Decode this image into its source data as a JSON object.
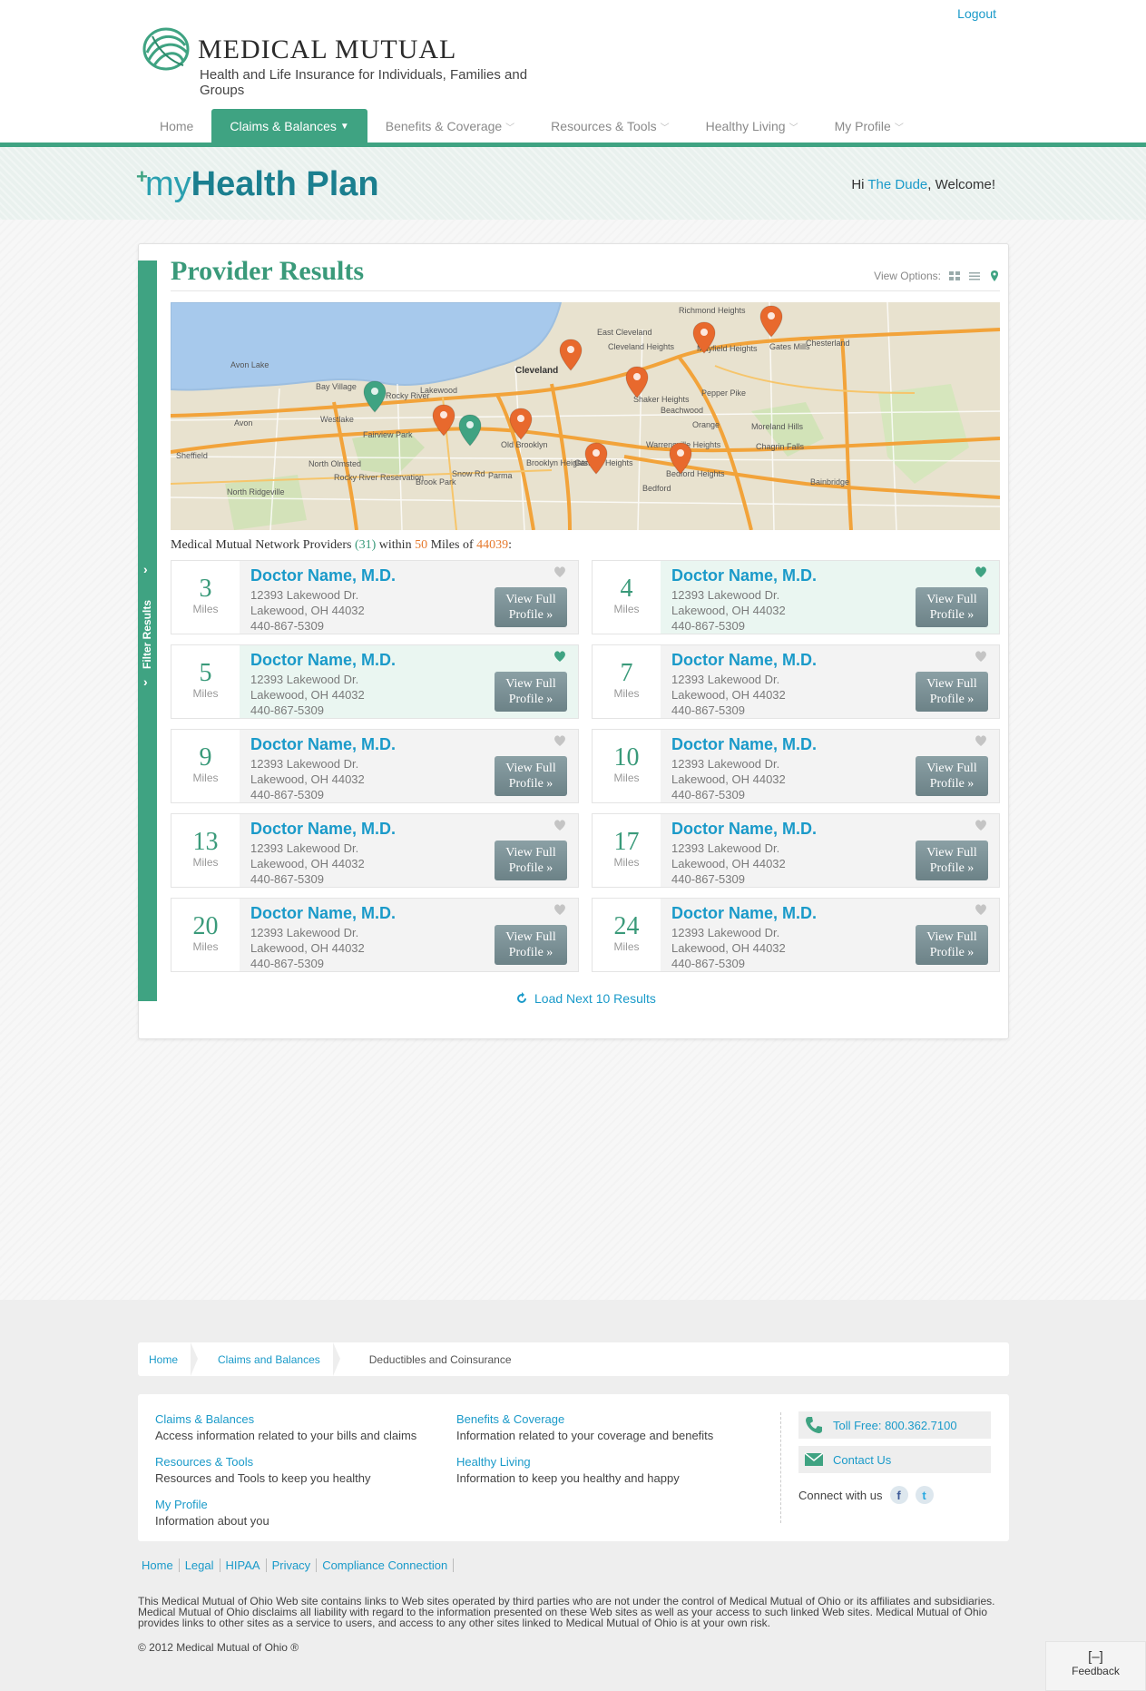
{
  "header": {
    "logout": "Logout",
    "brand": "MEDICAL MUTUAL",
    "tagline": "Health and Life Insurance for Individuals, Families and Groups"
  },
  "nav": {
    "items": [
      {
        "label": "Home",
        "active": false,
        "chevron": false
      },
      {
        "label": "Claims & Balances",
        "active": true,
        "chevron": true
      },
      {
        "label": "Benefits & Coverage",
        "active": false,
        "chevron": true
      },
      {
        "label": "Resources & Tools",
        "active": false,
        "chevron": true
      },
      {
        "label": "Healthy Living",
        "active": false,
        "chevron": true
      },
      {
        "label": "My Profile",
        "active": false,
        "chevron": true
      }
    ]
  },
  "banner": {
    "title_my": "my",
    "title_hp": "Health Plan",
    "greeting_prefix": "Hi ",
    "user": "The Dude",
    "greeting_suffix": ", Welcome!"
  },
  "filter": {
    "label": "Filter Results"
  },
  "results_page": {
    "title": "Provider Results",
    "view_options_label": "View Options:",
    "summary": {
      "prefix": "Medical Mutual Network Providers ",
      "count": "(31)",
      "within": " within ",
      "miles": "50",
      "miles_of": " Miles of ",
      "zip": "44039",
      "suffix": ":"
    },
    "load_next": "Load Next 10 Results"
  },
  "map": {
    "labels": [
      "Cleveland",
      "Lakewood",
      "Westlake",
      "Fairview Park",
      "North Olmsted",
      "Parma",
      "Avon Lake",
      "Bay Village",
      "Rocky River",
      "Avon",
      "Old Brooklyn",
      "Brooklyn Heights",
      "Garfield Heights",
      "Shaker Heights",
      "Cleveland Heights",
      "East Cleveland",
      "Richmond Heights",
      "Mayfield Heights",
      "Gates Mills",
      "Chesterland",
      "Pepper Pike",
      "Beachwood",
      "Warrensville Heights",
      "Bedford Heights",
      "Bedford",
      "Orange",
      "Moreland Hills",
      "Chagrin Falls",
      "Bainbridge",
      "Brook Park",
      "Rocky River Reservation",
      "North Ridgeville",
      "Sheffield",
      "Snow Rd"
    ],
    "pins": [
      {
        "color": "#3fa382"
      },
      {
        "color": "#3fa382"
      },
      {
        "color": "#e8692d"
      },
      {
        "color": "#e8692d"
      },
      {
        "color": "#e8692d"
      },
      {
        "color": "#e8692d"
      },
      {
        "color": "#e8692d"
      },
      {
        "color": "#e8692d"
      },
      {
        "color": "#e8692d"
      },
      {
        "color": "#e8692d"
      }
    ]
  },
  "results": [
    {
      "miles": "3",
      "unit": "Miles",
      "name": "Doctor Name, M.D.",
      "street": "12393 Lakewood Dr.",
      "city": "Lakewood, OH 44032",
      "phone": "440-867-5309",
      "favorite": false,
      "button": "View Full Profile »"
    },
    {
      "miles": "4",
      "unit": "Miles",
      "name": "Doctor Name, M.D.",
      "street": "12393 Lakewood Dr.",
      "city": "Lakewood, OH 44032",
      "phone": "440-867-5309",
      "favorite": true,
      "button": "View Full Profile »"
    },
    {
      "miles": "5",
      "unit": "Miles",
      "name": "Doctor Name, M.D.",
      "street": "12393 Lakewood Dr.",
      "city": "Lakewood, OH 44032",
      "phone": "440-867-5309",
      "favorite": true,
      "button": "View Full Profile »"
    },
    {
      "miles": "7",
      "unit": "Miles",
      "name": "Doctor Name, M.D.",
      "street": "12393 Lakewood Dr.",
      "city": "Lakewood, OH 44032",
      "phone": "440-867-5309",
      "favorite": false,
      "button": "View Full Profile »"
    },
    {
      "miles": "9",
      "unit": "Miles",
      "name": "Doctor Name, M.D.",
      "street": "12393 Lakewood Dr.",
      "city": "Lakewood, OH 44032",
      "phone": "440-867-5309",
      "favorite": false,
      "button": "View Full Profile »"
    },
    {
      "miles": "10",
      "unit": "Miles",
      "name": "Doctor Name, M.D.",
      "street": "12393 Lakewood Dr.",
      "city": "Lakewood, OH 44032",
      "phone": "440-867-5309",
      "favorite": false,
      "button": "View Full Profile »"
    },
    {
      "miles": "13",
      "unit": "Miles",
      "name": "Doctor Name, M.D.",
      "street": "12393 Lakewood Dr.",
      "city": "Lakewood, OH 44032",
      "phone": "440-867-5309",
      "favorite": false,
      "button": "View Full Profile »"
    },
    {
      "miles": "17",
      "unit": "Miles",
      "name": "Doctor Name, M.D.",
      "street": "12393 Lakewood Dr.",
      "city": "Lakewood, OH 44032",
      "phone": "440-867-5309",
      "favorite": false,
      "button": "View Full Profile »"
    },
    {
      "miles": "20",
      "unit": "Miles",
      "name": "Doctor Name, M.D.",
      "street": "12393 Lakewood Dr.",
      "city": "Lakewood, OH 44032",
      "phone": "440-867-5309",
      "favorite": false,
      "button": "View Full Profile »"
    },
    {
      "miles": "24",
      "unit": "Miles",
      "name": "Doctor Name, M.D.",
      "street": "12393 Lakewood Dr.",
      "city": "Lakewood, OH 44032",
      "phone": "440-867-5309",
      "favorite": false,
      "button": "View Full Profile »"
    }
  ],
  "breadcrumb": {
    "home": "Home",
    "section": "Claims and Balances",
    "current": "Deductibles and Coinsurance"
  },
  "footer": {
    "col1": [
      {
        "link": "Claims & Balances",
        "desc": "Access information related to your bills and claims"
      },
      {
        "link": "Resources & Tools",
        "desc": "Resources and Tools to keep you healthy"
      },
      {
        "link": "My Profile",
        "desc": "Information about you"
      }
    ],
    "col2": [
      {
        "link": "Benefits & Coverage",
        "desc": "Information related to your coverage and benefits"
      },
      {
        "link": "Healthy Living",
        "desc": "Information to keep you healthy and happy"
      }
    ],
    "toll_free": "Toll Free: 800.362.7100",
    "contact": "Contact Us",
    "connect": "Connect with us",
    "links": [
      "Home",
      "Legal",
      "HIPAA",
      "Privacy",
      "Compliance Connection"
    ],
    "disclaimer": "This Medical Mutual of Ohio Web site contains links to Web sites operated by third parties who are not under the control of Medical Mutual of Ohio or its affiliates and subsidiaries. Medical Mutual of Ohio disclaims all liability with regard to the information presented on these Web sites as well as your access to such linked Web sites. Medical Mutual of Ohio provides links to other sites as a service to users, and access to any other sites linked to Medical Mutual of Ohio is at your own risk.",
    "copyright": "© 2012 Medical Mutual of Ohio ®",
    "feedback": "Feedback"
  },
  "colors": {
    "brand_green": "#3fa382",
    "link_blue": "#1a9ac9",
    "pin_orange": "#e8692d"
  }
}
